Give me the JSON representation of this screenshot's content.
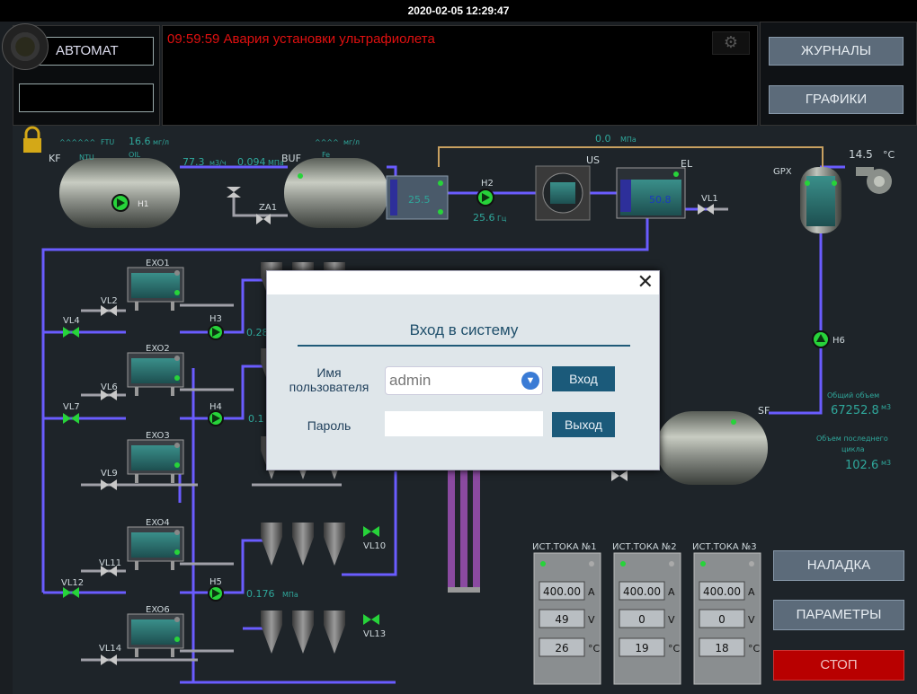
{
  "topbar": {
    "datetime": "2020-02-05 12:29:47"
  },
  "mode": {
    "label": "АВТОМАТ",
    "second_field": ""
  },
  "alarm": {
    "text": "09:59:59 Авария установки ультрафиолета"
  },
  "nav": {
    "journals": "ЖУРНАЛЫ",
    "charts": "ГРАФИКИ"
  },
  "side": {
    "setup": "НАЛАДКА",
    "params": "ПАРАМЕТРЫ",
    "stop": "СТОП"
  },
  "colors": {
    "pipe": "#6a5cff",
    "pipe_light": "#8f85ff",
    "alarm": "#e01010",
    "value": "#2fa79b",
    "stop": "#b80000"
  },
  "plant": {
    "kf": {
      "name": "KF",
      "ftu_waves": "^^^^^^",
      "ftu": "FTU",
      "ntu": "NTU",
      "ftu_value": "16.6",
      "ftu_unit": "мг/л",
      "oil": "OIL"
    },
    "h1": "H1",
    "flow": {
      "value": "77.3",
      "unit": "м3/ч"
    },
    "pressure1": {
      "value": "0.094",
      "unit": "МПа"
    },
    "za1": "ZA1",
    "buf": {
      "name": "BUF",
      "waves": "^^^^",
      "unit": "мг/л",
      "fe": "Fe"
    },
    "top_pressure": {
      "value": "0.0",
      "unit": "МПа"
    },
    "tank_value": "25.5",
    "h2": {
      "name": "H2",
      "value": "25.6",
      "unit": "Гц"
    },
    "us": "US",
    "el": {
      "name": "EL",
      "value": "50.8"
    },
    "vl1": "VL1",
    "gpx": "GPX",
    "temp": {
      "value": "14.5",
      "unit": "°C"
    },
    "h6": "H6",
    "total_volume": {
      "label": "Общий объем",
      "value": "67252.8",
      "unit": "м3"
    },
    "last_cycle": {
      "label_1": "Объем последнего",
      "label_2": "цикла",
      "value": "102.6",
      "unit": "м3"
    },
    "sf": "SF",
    "exo": [
      "EXO1",
      "EXO2",
      "EXO3",
      "EXO4",
      "EXO6"
    ],
    "valves": [
      "VL2",
      "VL4",
      "VL6",
      "VL7",
      "VL9",
      "VL11",
      "VL12",
      "VL14",
      "VL10",
      "VL13"
    ],
    "pumps": {
      "h3": "H3",
      "h4": "H4",
      "h5": "H5"
    },
    "p_h3": "0.28",
    "p_h4": "0.1",
    "p_h5": {
      "value": "0.176",
      "unit": "МПа"
    },
    "sources": [
      {
        "title": "ИСТ.ТОКА №1",
        "a": "400.00",
        "v": "49",
        "c": "26"
      },
      {
        "title": "ИСТ.ТОКА №2",
        "a": "400.00",
        "v": "0",
        "c": "19"
      },
      {
        "title": "ИСТ.ТОКА №3",
        "a": "400.00",
        "v": "0",
        "c": "18"
      }
    ],
    "units": {
      "a": "A",
      "v": "V",
      "c": "°C"
    }
  },
  "dialog": {
    "close": "✕",
    "title": "Вход в систему",
    "user_label_1": "Имя",
    "user_label_2": "пользователя",
    "user_value": "admin",
    "password_label": "Пароль",
    "login_button": "Вход",
    "exit_button": "Выход"
  }
}
